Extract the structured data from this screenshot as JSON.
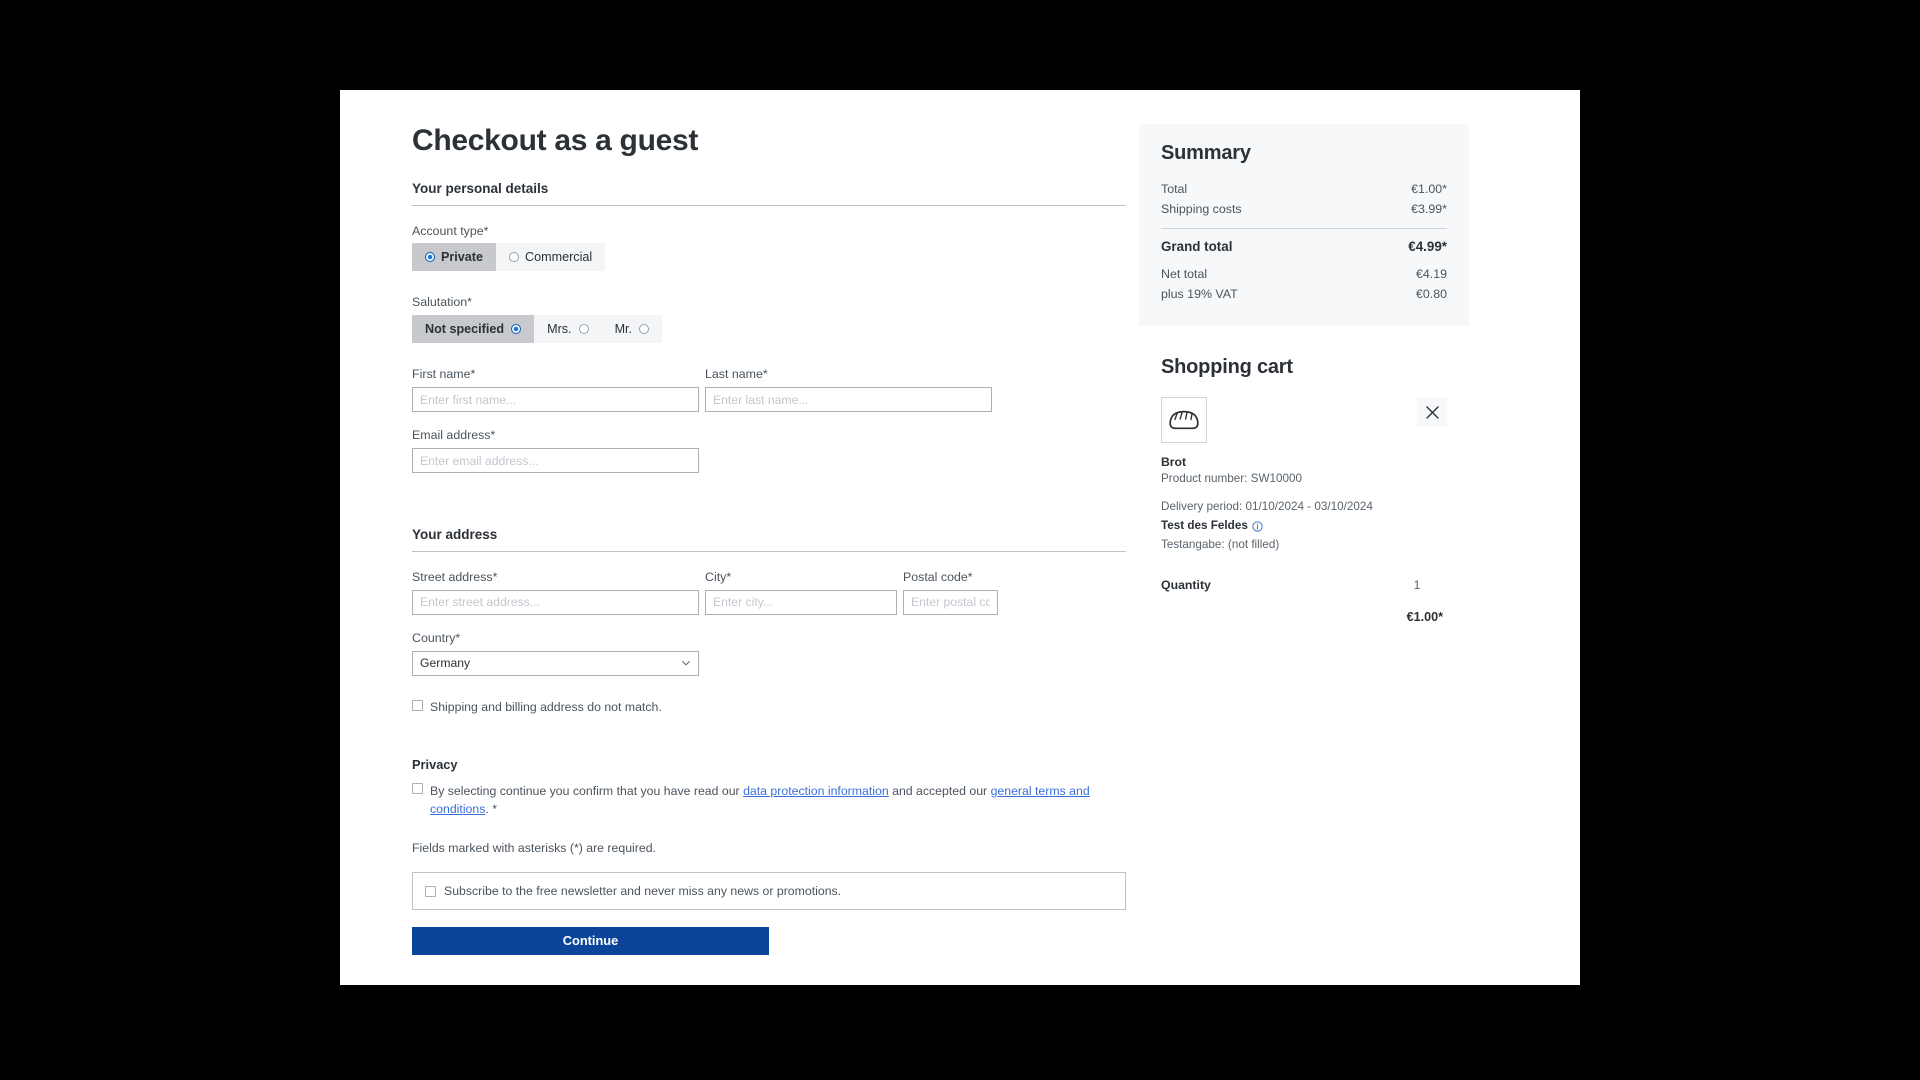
{
  "main": {
    "title": "Checkout as a guest",
    "personal_section": "Your personal details",
    "address_section": "Your address",
    "account_type_label": "Account type*",
    "account_type_options": [
      {
        "label": "Private",
        "selected": true
      },
      {
        "label": "Commercial",
        "selected": false
      }
    ],
    "salutation_label": "Salutation*",
    "salutation_options": [
      {
        "label": "Not specified",
        "selected": true
      },
      {
        "label": "Mrs.",
        "selected": false
      },
      {
        "label": "Mr.",
        "selected": false
      }
    ],
    "first_name_label": "First name*",
    "first_name_placeholder": "Enter first name...",
    "first_name_value": "",
    "last_name_label": "Last name*",
    "last_name_placeholder": "Enter last name...",
    "last_name_value": "",
    "email_label": "Email address*",
    "email_placeholder": "Enter email address...",
    "email_value": "",
    "street_label": "Street address*",
    "street_placeholder": "Enter street address...",
    "street_value": "",
    "city_label": "City*",
    "city_placeholder": "Enter city...",
    "city_value": "",
    "postal_label": "Postal code*",
    "postal_placeholder": "Enter postal code.",
    "postal_value": "",
    "country_label": "Country*",
    "country_value": "Germany",
    "shipping_mismatch_label": "Shipping and billing address do not match.",
    "privacy_heading": "Privacy",
    "privacy_text_1": "By selecting continue you confirm that you have read our ",
    "privacy_link_1": "data protection information",
    "privacy_text_2": " and accepted our ",
    "privacy_link_2": "general terms and conditions",
    "privacy_text_3": ". *",
    "required_note": "Fields marked with asterisks (*) are required.",
    "newsletter_label": "Subscribe to the free newsletter and never miss any news or promotions.",
    "continue_label": "Continue"
  },
  "summary": {
    "title": "Summary",
    "rows": [
      {
        "label": "Total",
        "value": "€1.00*"
      },
      {
        "label": "Shipping costs",
        "value": "€3.99*"
      }
    ],
    "grand_label": "Grand total",
    "grand_value": "€4.99*",
    "net_rows": [
      {
        "label": "Net total",
        "value": "€4.19"
      },
      {
        "label": "plus 19% VAT",
        "value": "€0.80"
      }
    ]
  },
  "cart": {
    "title": "Shopping cart",
    "product_name": "Brot",
    "product_number": "Product number: SW10000",
    "delivery_period": "Delivery period: 01/10/2024 - 03/10/2024",
    "custom_field_label": "Test des Feldes",
    "custom_field_value": "Testangabe: (not filled)",
    "quantity_label": "Quantity",
    "quantity_value": "1",
    "line_price": "€1.00*"
  },
  "colors": {
    "primary": "#0b4499",
    "link": "#3a6fd8",
    "text": "#2b3137",
    "muted": "#4a545e",
    "panel": "#f7f8f9",
    "radio_selected_bg": "#c7c9cc",
    "accent_blue": "#1e74d4"
  }
}
